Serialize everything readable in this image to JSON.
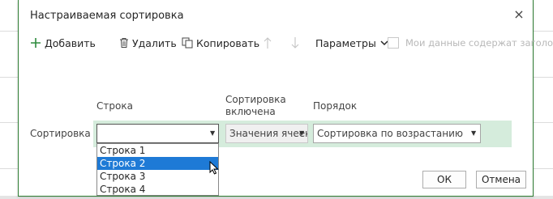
{
  "dialog": {
    "title": "Настраиваемая сортировка",
    "close_glyph": "×"
  },
  "toolbar": {
    "add_label": "Добавить",
    "delete_label": "Удалить",
    "copy_label": "Копировать",
    "params_label": "Параметры",
    "headers_checkbox_label": "Мои данные содержат заголовки",
    "headers_checked": false
  },
  "columns": {
    "row_header": "Строка",
    "sort_on_header_line1": "Сортировка",
    "sort_on_header_line2": "включена",
    "order_header": "Порядок"
  },
  "sort_row": {
    "label": "Сортировка",
    "row_value": "",
    "sort_on_value": "Значения ячеек",
    "order_value": "Сортировка по возрастанию"
  },
  "dropdown": {
    "options": [
      "Строка 1",
      "Строка 2",
      "Строка 3",
      "Строка 4"
    ],
    "selected_index": 1
  },
  "buttons": {
    "ok_label": "ОК",
    "cancel_label": "Отмена"
  },
  "colors": {
    "accent": "#2e7d32",
    "row_highlight": "#d5ecdc",
    "selection": "#1e7ad6"
  }
}
